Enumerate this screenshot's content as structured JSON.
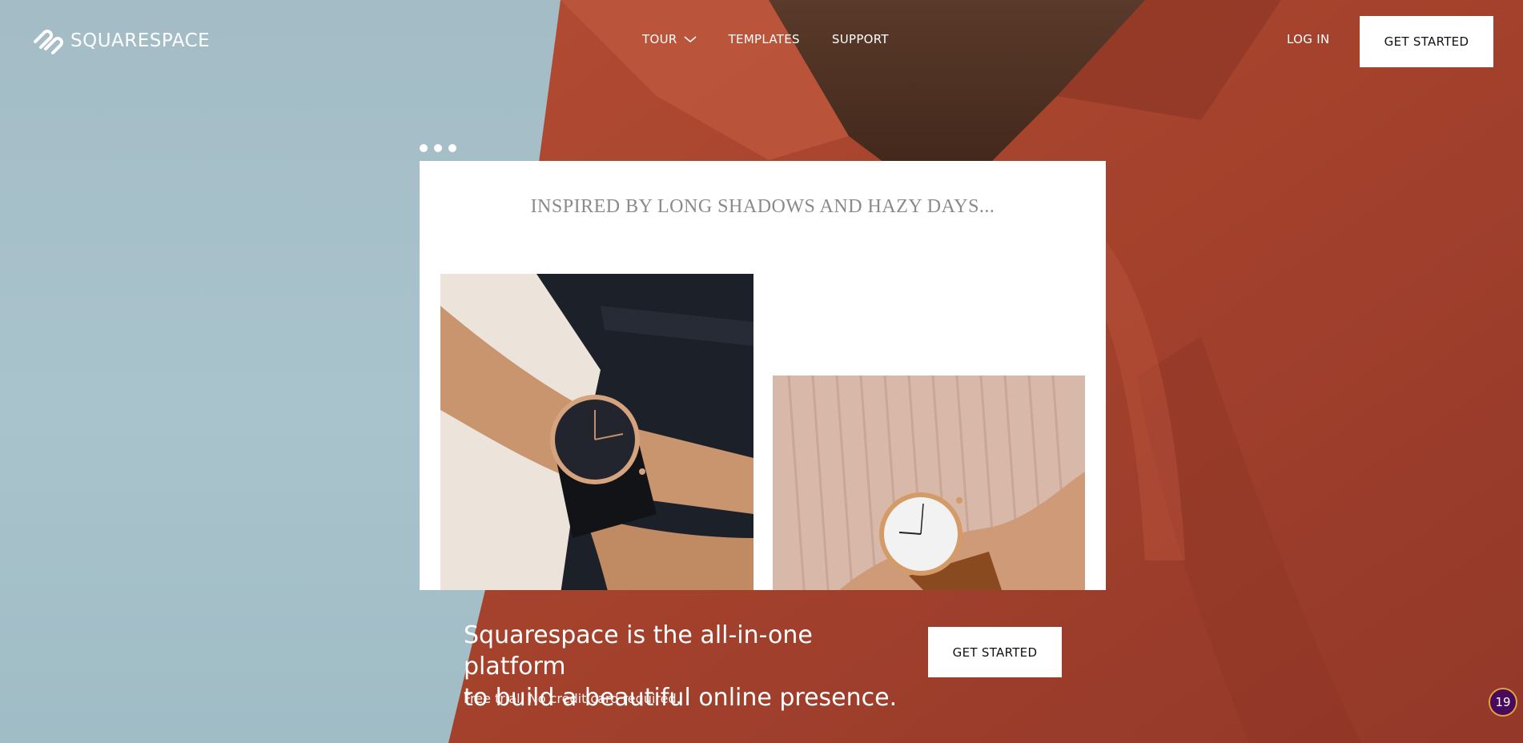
{
  "nav": {
    "brand": "SQUARESPACE",
    "links": [
      {
        "label": "TOUR",
        "has_dropdown": true
      },
      {
        "label": "TEMPLATES"
      },
      {
        "label": "SUPPORT"
      }
    ],
    "login_label": "LOG IN",
    "cta_label": "GET STARTED"
  },
  "mockup": {
    "heading": "INSPIRED BY LONG SHADOWS AND HAZY DAYS..."
  },
  "hero": {
    "headline_line1": "Squarespace is the all-in-one platform",
    "headline_line2": "to build a beautiful online presence.",
    "subtext": "Free trial. No credit card required.",
    "cta_label": "GET STARTED"
  },
  "badge": {
    "count": "19"
  },
  "colors": {
    "sky": "#a5bec8",
    "jacket": "#a7442f",
    "badge_fill": "#4a0a5c",
    "badge_ring": "#e2a43a"
  },
  "icons": [
    "squarespace-logo-icon",
    "chevron-down-icon"
  ]
}
